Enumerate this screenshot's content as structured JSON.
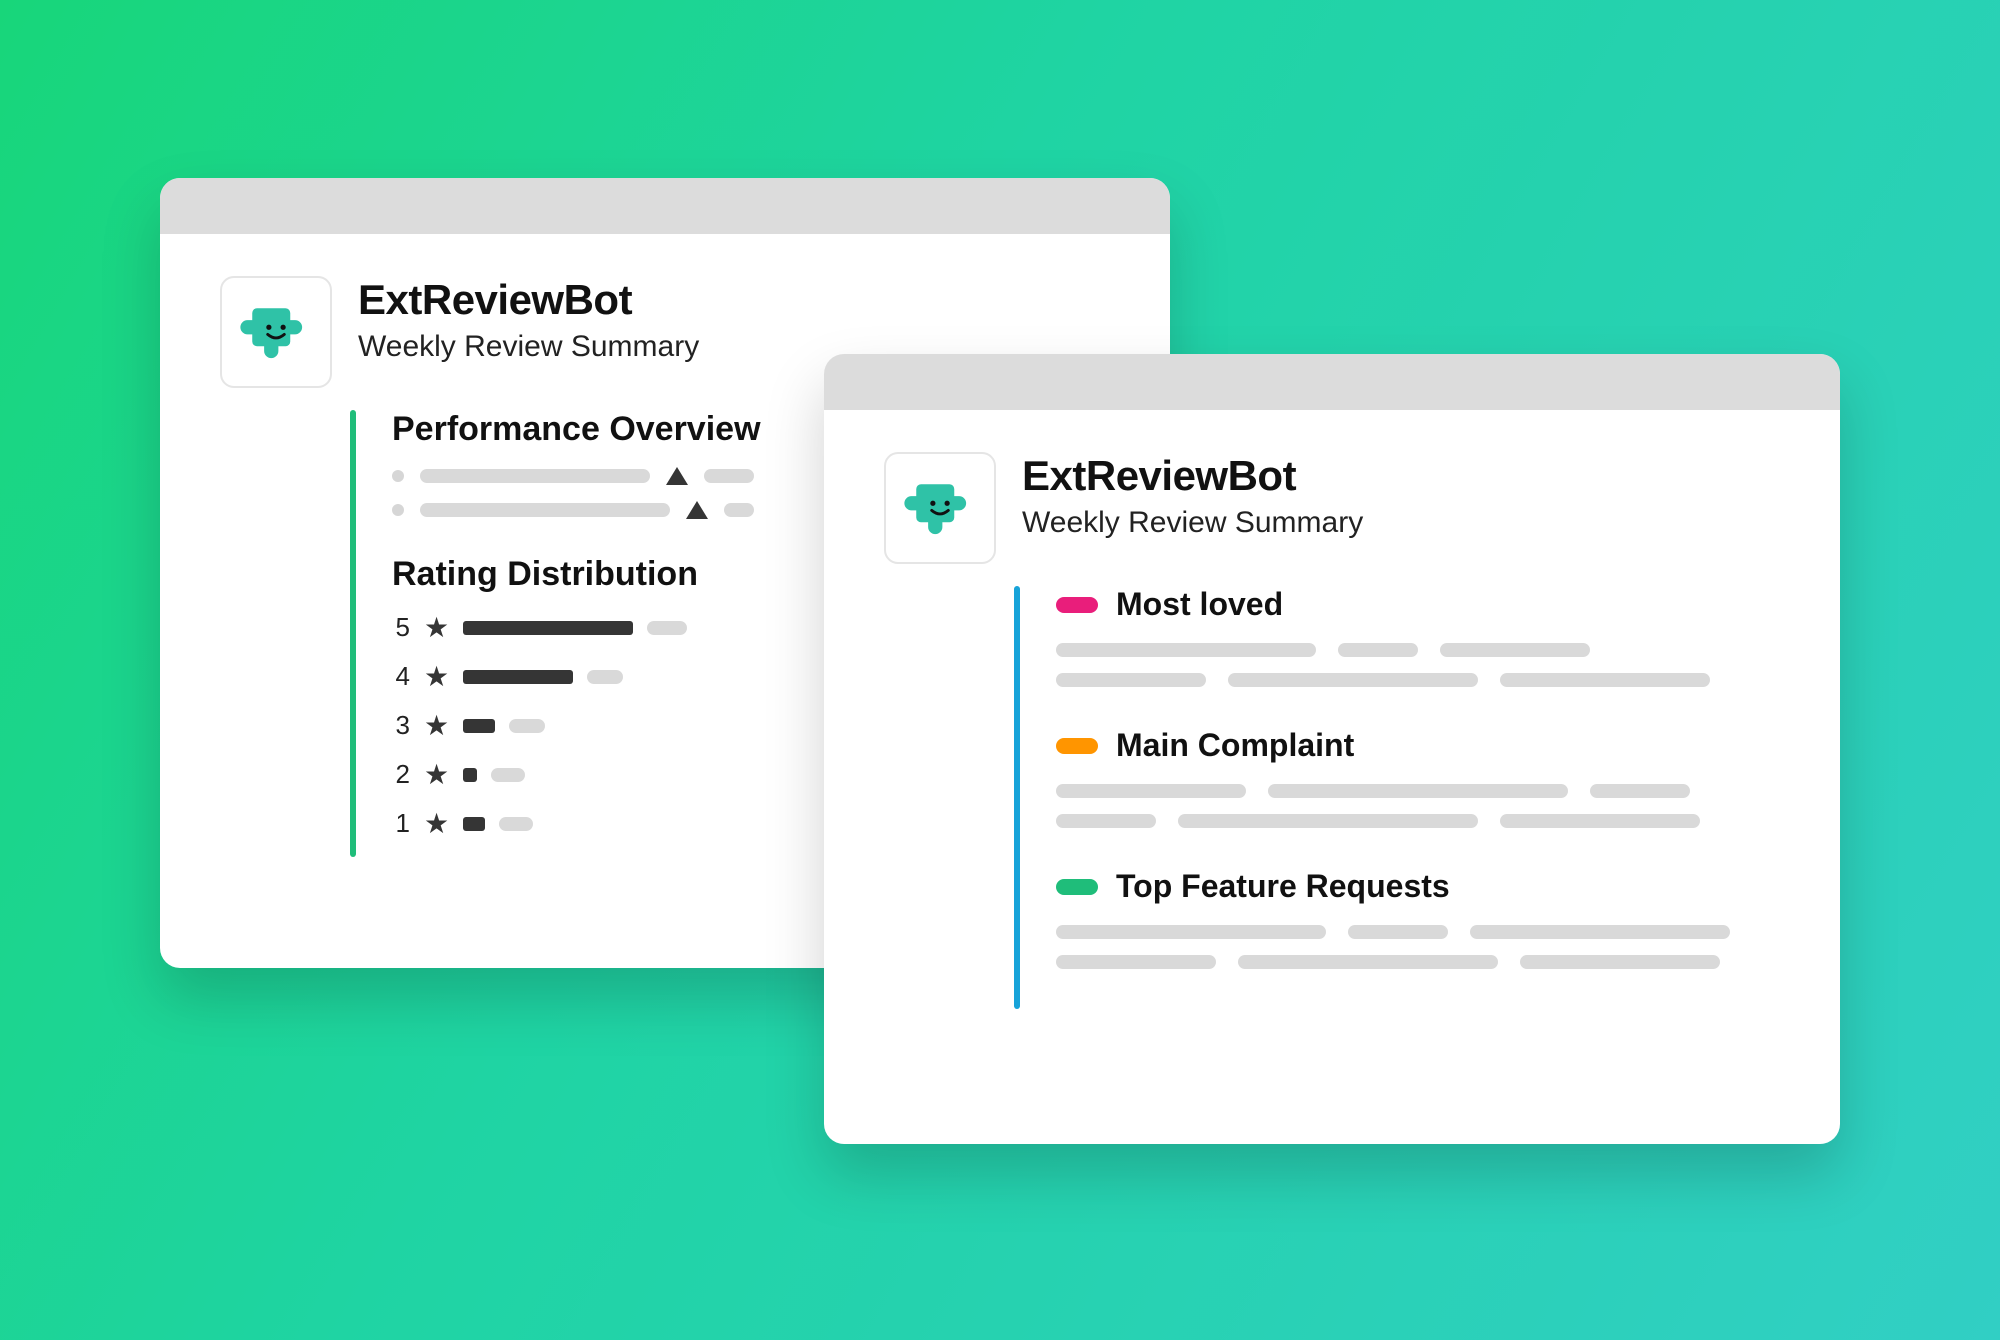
{
  "left": {
    "title": "ExtReviewBot",
    "subtitle": "Weekly Review Summary",
    "sections": {
      "performance_heading": "Performance Overview",
      "rating_heading": "Rating Distribution"
    },
    "ratings": [
      "5",
      "4",
      "3",
      "2",
      "1"
    ]
  },
  "right": {
    "title": "ExtReviewBot",
    "subtitle": "Weekly Review Summary",
    "insights": {
      "loved_label": "Most loved",
      "complaint_label": "Main Complaint",
      "requests_label": "Top Feature Requests"
    }
  },
  "colors": {
    "pink": "#e91e7b",
    "orange": "#ff9500",
    "green": "#1fbd7a",
    "blue": "#17a3d9"
  },
  "chart_data": {
    "type": "bar",
    "title": "Rating Distribution",
    "categories": [
      "5",
      "4",
      "3",
      "2",
      "1"
    ],
    "values": [
      170,
      110,
      32,
      14,
      22
    ],
    "xlabel": "",
    "ylabel": "",
    "ylim": [
      0,
      180
    ]
  }
}
